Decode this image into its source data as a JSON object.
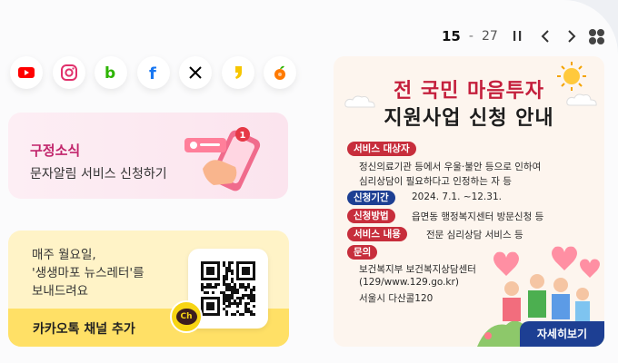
{
  "pager": {
    "current": "15",
    "separator": "-",
    "total": "27"
  },
  "social": [
    {
      "icon": "youtube-icon",
      "color": "#ff0000"
    },
    {
      "icon": "instagram-icon",
      "color": "#e1306c"
    },
    {
      "icon": "blog-icon",
      "color": "#2db400"
    },
    {
      "icon": "facebook-icon",
      "color": "#1877f2"
    },
    {
      "icon": "x-icon",
      "color": "#000000"
    },
    {
      "icon": "kakaostory-icon",
      "color": "#f7c600"
    },
    {
      "icon": "gallery-icon",
      "color": "#ff7a00"
    }
  ],
  "news_card": {
    "title": "구정소식",
    "subtitle": "문자알림 서비스 신청하기",
    "badge": "1"
  },
  "newsletter_card": {
    "line1": "매주 월요일,",
    "line2": "'생생마포 뉴스레터'를",
    "line3": "보내드려요",
    "kakao_label": "카카오톡 채널 추가",
    "ch_label": "Ch"
  },
  "banner": {
    "title_line1": "전 국민 마음투자",
    "title_line2": "지원사업 신청 안내",
    "target_tag": "서비스 대상자",
    "target_text1": "정신의료기관 등에서 우울·불안 등으로 인하여",
    "target_text2": "심리상담이 필요하다고 인정하는 자 등",
    "period_tag": "신청기간",
    "period_text": "2024. 7.1. ~12.31.",
    "method_tag": "신청방법",
    "method_text": "읍면동 행정복지센터 방문신청 등",
    "content_tag": "서비스 내용",
    "content_text": "전문 심리상담 서비스 등",
    "contact_tag": "문의",
    "contact_text1": "보건복지부 보건복지상담센터",
    "contact_text2": "(129/www.129.go.kr)",
    "contact_text3": "서울시 다산콜120",
    "more_label": "자세히보기"
  }
}
